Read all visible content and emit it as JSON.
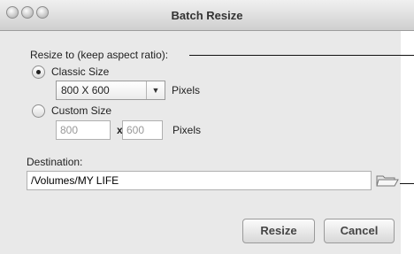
{
  "window": {
    "title": "Batch Resize"
  },
  "resize": {
    "section_label": "Resize to (keep aspect ratio):",
    "classic_label": "Classic Size",
    "classic_value": "800 X 600",
    "classic_unit": "Pixels",
    "custom_label": "Custom Size",
    "custom_width": "800",
    "custom_by": "x",
    "custom_height": "600",
    "custom_unit": "Pixels"
  },
  "destination": {
    "label": "Destination:",
    "path": "/Volumes/MY LIFE"
  },
  "buttons": {
    "resize": "Resize",
    "cancel": "Cancel"
  }
}
